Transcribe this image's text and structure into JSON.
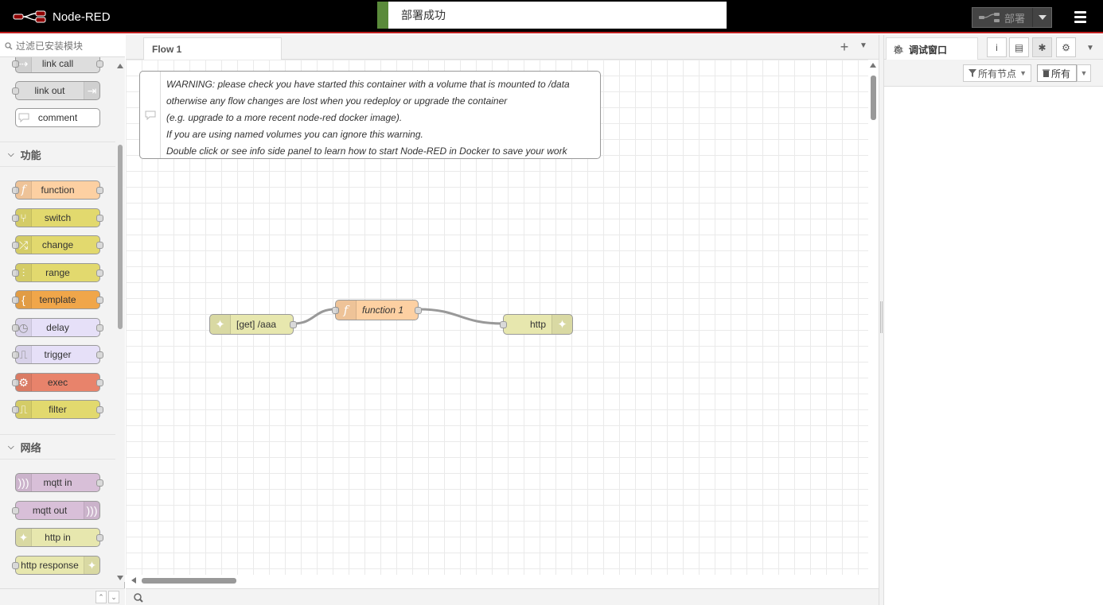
{
  "header": {
    "app_title": "Node-RED",
    "notification": "部署成功",
    "deploy_label": "部署",
    "colors": {
      "bar": "#000000",
      "accent": "#c02020",
      "success": "#5a8a3a"
    }
  },
  "palette": {
    "search_placeholder": "过滤已安装模块",
    "top_nodes": [
      {
        "label": "link call"
      },
      {
        "label": "link out"
      },
      {
        "label": "comment"
      }
    ],
    "categories": [
      {
        "name": "功能",
        "nodes": [
          {
            "label": "function",
            "color": "#fdd0a2"
          },
          {
            "label": "switch",
            "color": "#e2d96e"
          },
          {
            "label": "change",
            "color": "#e2d96e"
          },
          {
            "label": "range",
            "color": "#e2d96e"
          },
          {
            "label": "template",
            "color": "#f0a64a"
          },
          {
            "label": "delay",
            "color": "#e6e0f8"
          },
          {
            "label": "trigger",
            "color": "#e6e0f8"
          },
          {
            "label": "exec",
            "color": "#e8836b"
          },
          {
            "label": "filter",
            "color": "#e2d96e"
          }
        ]
      },
      {
        "name": "网络",
        "nodes": [
          {
            "label": "mqtt in",
            "color": "#d8bfd8"
          },
          {
            "label": "mqtt out",
            "color": "#d8bfd8"
          },
          {
            "label": "http in",
            "color": "#e7e7ae"
          },
          {
            "label": "http response",
            "color": "#e7e7ae"
          }
        ]
      }
    ]
  },
  "workspace": {
    "tabs": [
      {
        "label": "Flow 1"
      }
    ],
    "comment": {
      "lines": [
        "WARNING: please check you have started this container with a volume that is mounted to /data",
        "otherwise any flow changes are lost when you redeploy or upgrade the container",
        "(e.g. upgrade to a more recent node-red docker image).",
        "If you are using named volumes you can ignore this warning.",
        "Double click or see info side panel to learn how to start Node-RED in Docker to save your work"
      ]
    },
    "nodes": [
      {
        "id": "http-in",
        "label": "[get] /aaa",
        "color": "#e7e7ae"
      },
      {
        "id": "function",
        "label": "function 1",
        "color": "#fdd0a2"
      },
      {
        "id": "http-response",
        "label": "http",
        "color": "#e7e7ae"
      }
    ]
  },
  "sidebar": {
    "active_tab": "调试窗口",
    "filter_label": "所有节点",
    "clear_label": "所有",
    "tab_icons": [
      "info-icon",
      "book-icon",
      "bug-icon",
      "gear-icon"
    ]
  }
}
